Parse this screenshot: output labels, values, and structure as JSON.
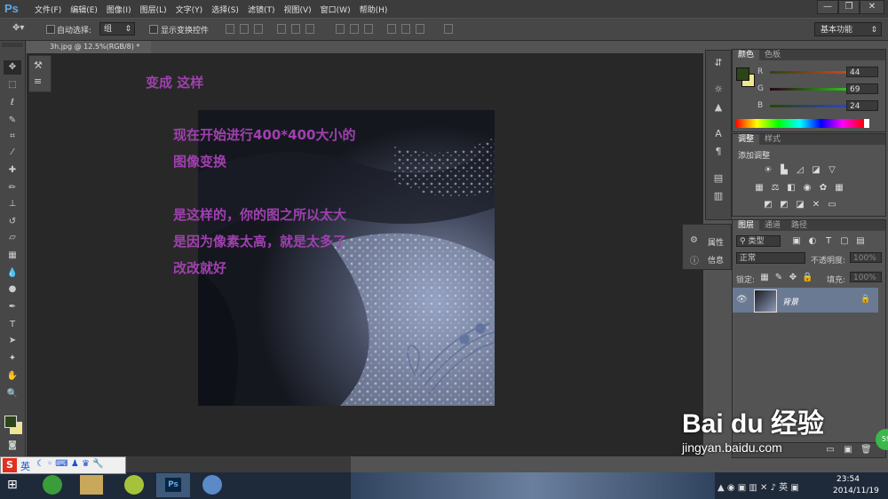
{
  "app": {
    "logo": "Ps"
  },
  "menu": [
    "文件(F)",
    "编辑(E)",
    "图像(I)",
    "图层(L)",
    "文字(Y)",
    "选择(S)",
    "滤镜(T)",
    "视图(V)",
    "窗口(W)",
    "帮助(H)"
  ],
  "window_controls": [
    "—",
    "❐",
    "✕"
  ],
  "options": {
    "auto_select_label": "自动选择:",
    "auto_select_value": "组",
    "show_transform_label": "显示变换控件",
    "workspace": "基本功能"
  },
  "document": {
    "tab_title": "3h.jpg @ 12.5%(RGB/8) *"
  },
  "annotations": {
    "line1": "变成 这样",
    "line2": "现在开始进行400*400大小的",
    "line3": "图像变换",
    "line4": "是这样的，你的图之所以太大",
    "line5": "是因为像素太高，就是太多了",
    "line6": "改改就好"
  },
  "flyout": {
    "properties": "属性",
    "info": "信息"
  },
  "color_panel": {
    "tabs": [
      "颜色",
      "色板"
    ],
    "r_label": "R",
    "g_label": "G",
    "b_label": "B",
    "r": "44",
    "g": "69",
    "b": "24",
    "foreground": "#2c4518",
    "background": "#f0e68c"
  },
  "adjust_panel": {
    "tabs": [
      "调整",
      "样式"
    ],
    "title": "添加调整"
  },
  "layers_panel": {
    "tabs": [
      "图层",
      "通道",
      "路径"
    ],
    "filter": "类型",
    "blend_mode": "正常",
    "opacity_label": "不透明度:",
    "opacity_value": "100%",
    "lock_label": "锁定:",
    "fill_label": "填充:",
    "fill_value": "100%",
    "layer_name": "背景"
  },
  "ime": {
    "label": "英"
  },
  "clock": {
    "time": "23:54",
    "date": "2014/11/19"
  },
  "watermark": {
    "brand": "Bai du 经验",
    "url": "jingyan.baidu.com"
  }
}
